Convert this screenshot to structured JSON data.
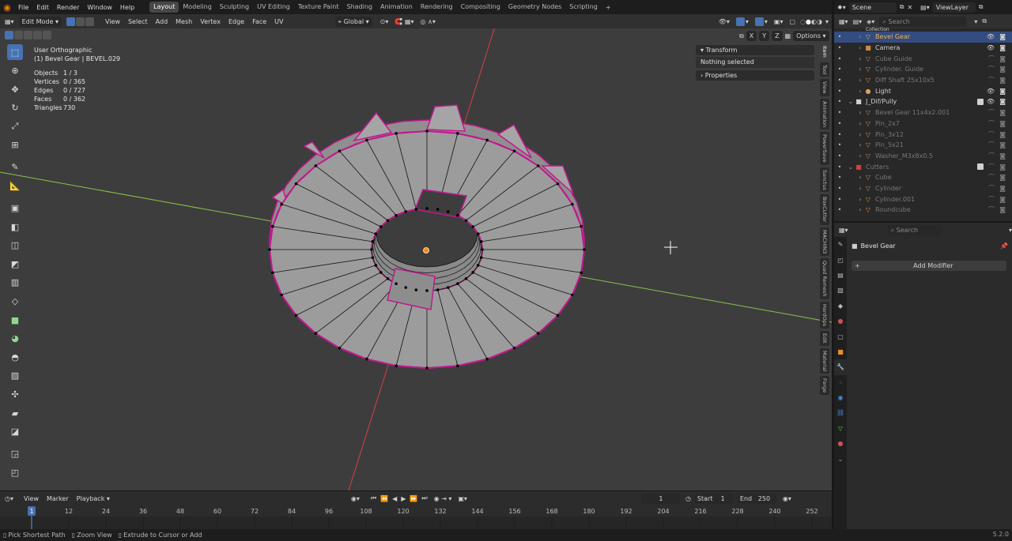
{
  "topbar": {
    "menus": [
      "File",
      "Edit",
      "Render",
      "Window",
      "Help"
    ],
    "workspaces": [
      "Layout",
      "Modeling",
      "Sculpting",
      "UV Editing",
      "Texture Paint",
      "Shading",
      "Animation",
      "Rendering",
      "Compositing",
      "Geometry Nodes",
      "Scripting"
    ],
    "active_workspace": "Layout",
    "add_tab": "+"
  },
  "scene": {
    "label": "Scene",
    "viewlayer": "ViewLayer",
    "search_placeholder": "Search"
  },
  "viewport_header": {
    "mode": "Edit Mode",
    "menus": [
      "View",
      "Select",
      "Add",
      "Mesh",
      "Vertex",
      "Edge",
      "Face",
      "UV"
    ],
    "orientation": "Global",
    "options": "Options",
    "axes": [
      "X",
      "Y",
      "Z"
    ]
  },
  "overlay": {
    "view_name": "User Orthographic",
    "object_line": "(1) Bevel Gear | BEVEL.029"
  },
  "stats": [
    {
      "k": "Objects",
      "v": "1 / 3"
    },
    {
      "k": "Vertices",
      "v": "0 / 365"
    },
    {
      "k": "Edges",
      "v": "0 / 727"
    },
    {
      "k": "Faces",
      "v": "0 / 362"
    },
    {
      "k": "Triangles",
      "v": "730"
    }
  ],
  "npanel": {
    "transform": "Transform",
    "nothing": "Nothing selected",
    "properties": "Properties"
  },
  "side_tabs": [
    "Item",
    "Tool",
    "View",
    "Animation",
    "PowerSave",
    "Sanctus",
    "BoxCutter",
    "MACHIN3",
    "Quad Remesh",
    "HardOps",
    "Edit",
    "Material",
    "Forge"
  ],
  "outliner": {
    "collection_label": "Collection",
    "rows": [
      {
        "name": "Bevel Gear",
        "sel": true,
        "dim": false,
        "icon": "▽",
        "color": "#e0a060",
        "indent": 1,
        "vis": true
      },
      {
        "name": "Camera",
        "sel": false,
        "dim": false,
        "icon": "■",
        "color": "#c98a4b",
        "indent": 1,
        "vis": true
      },
      {
        "name": "Cube Guide",
        "sel": false,
        "dim": true,
        "icon": "▽",
        "color": "#c98a4b",
        "indent": 1,
        "vis": false
      },
      {
        "name": "Cylinder. Guide",
        "sel": false,
        "dim": true,
        "icon": "▽",
        "color": "#c98a4b",
        "indent": 1,
        "vis": false
      },
      {
        "name": "Diff Shaft 25x10x5",
        "sel": false,
        "dim": true,
        "icon": "▽",
        "color": "#c98a4b",
        "indent": 1,
        "vis": false
      },
      {
        "name": "Light",
        "sel": false,
        "dim": false,
        "icon": "●",
        "color": "#e0a060",
        "indent": 1,
        "vis": true
      },
      {
        "name": "J_Dif/Pully",
        "sel": false,
        "dim": false,
        "icon": "■",
        "color": "#d0d0d0",
        "indent": 0,
        "vis": true,
        "collection": true
      },
      {
        "name": "Bevel Gear 11x4x2.001",
        "sel": false,
        "dim": true,
        "icon": "▽",
        "color": "#c98a4b",
        "indent": 1,
        "vis": false
      },
      {
        "name": "Pin_2x7",
        "sel": false,
        "dim": true,
        "icon": "▽",
        "color": "#c98a4b",
        "indent": 1,
        "vis": false
      },
      {
        "name": "Pin_3x12",
        "sel": false,
        "dim": true,
        "icon": "▽",
        "color": "#c98a4b",
        "indent": 1,
        "vis": false
      },
      {
        "name": "Pin_5x21",
        "sel": false,
        "dim": true,
        "icon": "▽",
        "color": "#c98a4b",
        "indent": 1,
        "vis": false
      },
      {
        "name": "Washer_M3x8x0.5",
        "sel": false,
        "dim": true,
        "icon": "▽",
        "color": "#c98a4b",
        "indent": 1,
        "vis": false
      },
      {
        "name": "Cutters",
        "sel": false,
        "dim": true,
        "icon": "■",
        "color": "#d04040",
        "indent": 0,
        "vis": false,
        "collection": true
      },
      {
        "name": "Cube",
        "sel": false,
        "dim": true,
        "icon": "▽",
        "color": "#c98a4b",
        "indent": 1,
        "vis": false
      },
      {
        "name": "Cylinder",
        "sel": false,
        "dim": true,
        "icon": "▽",
        "color": "#c98a4b",
        "indent": 1,
        "vis": false
      },
      {
        "name": "Cylinder.001",
        "sel": false,
        "dim": true,
        "icon": "▽",
        "color": "#c98a4b",
        "indent": 1,
        "vis": false
      },
      {
        "name": "Roundcube",
        "sel": false,
        "dim": true,
        "icon": "▽",
        "color": "#c98a4b",
        "indent": 1,
        "vis": false
      }
    ]
  },
  "properties": {
    "object_name": "Bevel Gear",
    "add_modifier": "Add Modifier",
    "search_placeholder": "Search"
  },
  "timeline": {
    "menus": [
      "View",
      "Marker",
      "Playback"
    ],
    "current_frame": "1",
    "start_label": "Start",
    "start": "1",
    "end_label": "End",
    "end": "250",
    "ticks": [
      "12",
      "24",
      "36",
      "48",
      "60",
      "72",
      "84",
      "96",
      "108",
      "120",
      "132",
      "144",
      "156",
      "168",
      "180",
      "192",
      "204",
      "216",
      "228",
      "240",
      "252"
    ],
    "frame_marker": "1"
  },
  "status": {
    "items": [
      "Pick Shortest Path",
      "Zoom View",
      "Extrude to Cursor or Add"
    ],
    "version": "5.2.0"
  },
  "colors": {
    "accent": "#4772b3",
    "edge_outline": "#c2188e",
    "x_axis": "#d84040",
    "y_axis": "#8bc34a",
    "mesh_face": "#9a9a9a"
  }
}
